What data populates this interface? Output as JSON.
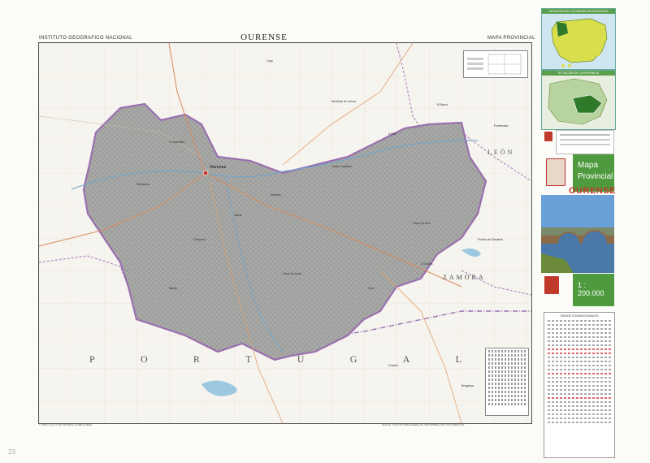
{
  "header": {
    "left": "INSTITUTO GEOGRAFICO NACIONAL",
    "title": "OURENSE",
    "right": "MAPA PROVINCIAL"
  },
  "map": {
    "neighbors": {
      "portugal_letters": [
        "P",
        "O",
        "R",
        "T",
        "U",
        "G",
        "A",
        "L"
      ],
      "zamora": "ZAMORA",
      "leon": "LEÓN"
    },
    "colors": {
      "province_fill": "#a9aaa8",
      "province_border": "#9a6fb0",
      "background": "#f6f4ee",
      "water": "#9cc8e0",
      "roads": "#d98a5a"
    },
    "places": [
      {
        "name": "Ourense",
        "kind": "capital"
      },
      {
        "name": "El Barco",
        "kind": "town"
      },
      {
        "name": "Verín",
        "kind": "town"
      },
      {
        "name": "Xinzo de Limia",
        "kind": "town"
      },
      {
        "name": "O Carballiño",
        "kind": "town"
      },
      {
        "name": "Celanova",
        "kind": "town"
      },
      {
        "name": "A Rúa",
        "kind": "town"
      },
      {
        "name": "Ribadavia",
        "kind": "town"
      },
      {
        "name": "Viana do Bolo",
        "kind": "town"
      },
      {
        "name": "Allariz",
        "kind": "town"
      },
      {
        "name": "Bande",
        "kind": "town"
      },
      {
        "name": "A Gudiña",
        "kind": "town"
      },
      {
        "name": "Maceda",
        "kind": "town"
      },
      {
        "name": "Castro Caldelas",
        "kind": "town"
      },
      {
        "name": "Chaves",
        "kind": "town"
      },
      {
        "name": "Bragança",
        "kind": "town"
      },
      {
        "name": "Ponferrada",
        "kind": "town"
      },
      {
        "name": "Lugo",
        "kind": "town"
      },
      {
        "name": "Monforte de Lemos",
        "kind": "town"
      },
      {
        "name": "Puebla de Sanabria",
        "kind": "town"
      }
    ]
  },
  "cover": {
    "inset1_caption": "SITUACIÓN DE LOS MAPAS PROVINCIALES",
    "inset2_caption": "SITUACIÓN DE LA PROVINCIA",
    "panel_line1": "Mapa",
    "panel_line2": "Provincial",
    "province_name": "OURENSE",
    "scale": "1 : 200.000",
    "info_title": "SIGNOS CONVENCIONALES"
  },
  "footer": {
    "left": "© INSTITUTO GEOGRAFICO NACIONAL",
    "right": "EDITA: CENTRO NACIONAL DE INFORMACION GEOGRAFICA"
  },
  "stamps": [
    "23"
  ]
}
